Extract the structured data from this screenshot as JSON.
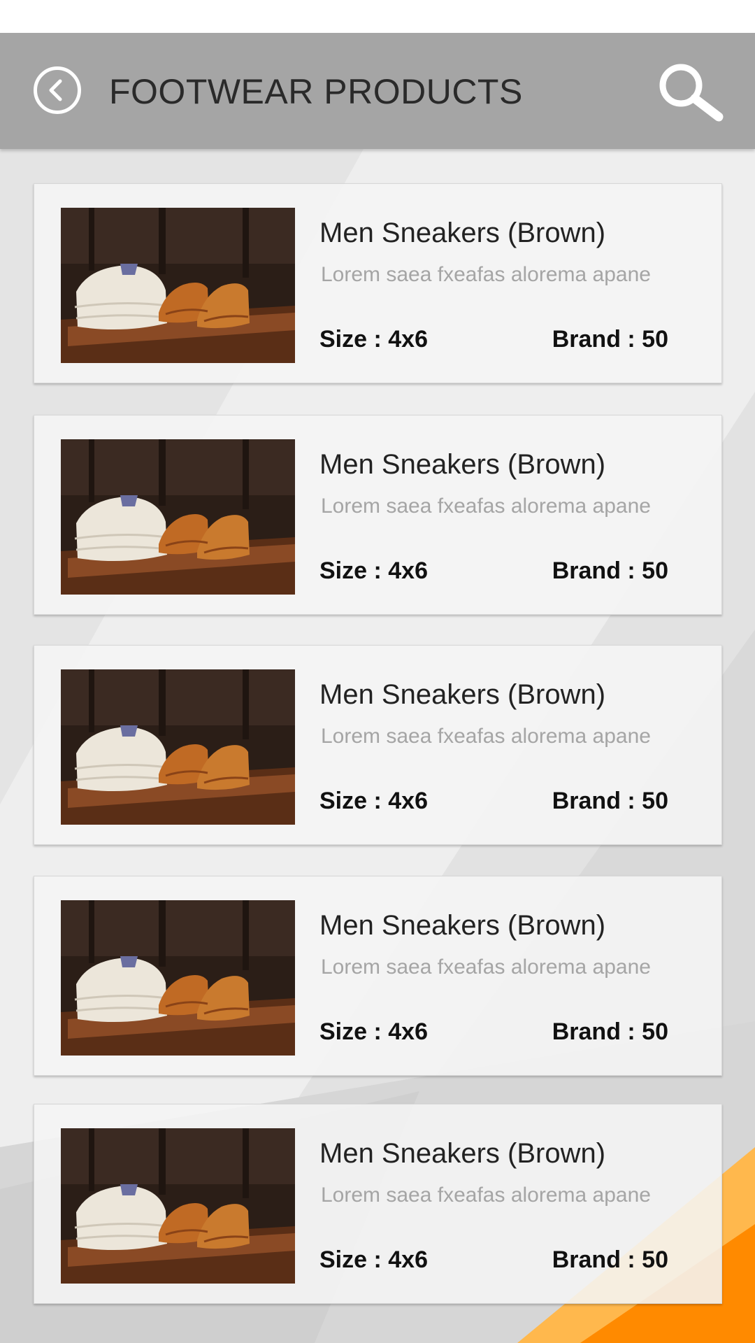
{
  "header": {
    "title": "FOOTWEAR PRODUCTS",
    "back_icon": "back-arrow-circle-icon",
    "search_icon": "search-icon"
  },
  "colors": {
    "header_bg": "#a5a5a5",
    "accent_orange": "#ff8a00",
    "accent_light_orange": "#ffb84d"
  },
  "products": [
    {
      "title": "Men Sneakers (Brown)",
      "description": "Lorem saea fxeafas alorema apane",
      "size": "Size : 4x6",
      "brand": "Brand : 50"
    },
    {
      "title": "Men Sneakers (Brown)",
      "description": "Lorem saea fxeafas alorema apane",
      "size": "Size : 4x6",
      "brand": "Brand : 50"
    },
    {
      "title": "Men Sneakers (Brown)",
      "description": "Lorem saea fxeafas alorema apane",
      "size": "Size : 4x6",
      "brand": "Brand : 50"
    },
    {
      "title": "Men Sneakers (Brown)",
      "description": "Lorem saea fxeafas alorema apane",
      "size": "Size : 4x6",
      "brand": "Brand : 50"
    },
    {
      "title": "Men Sneakers (Brown)",
      "description": "Lorem saea fxeafas alorema apane",
      "size": "Size : 4x6",
      "brand": "Brand : 50"
    }
  ]
}
